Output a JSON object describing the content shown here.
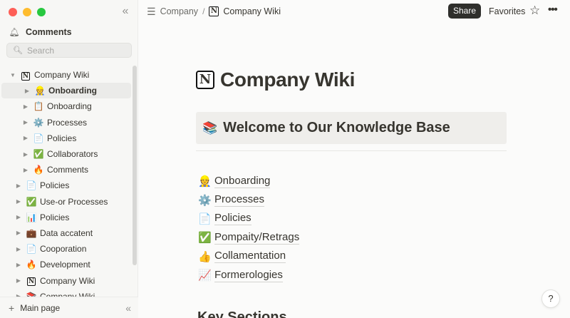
{
  "sidebar": {
    "comments_label": "Comments",
    "search_placeholder": "Search",
    "tree": [
      {
        "label": "Company Wiki",
        "emoji": "N",
        "level": 0,
        "expanded": true
      },
      {
        "label": "Onboarding",
        "emoji": "👷",
        "level": 1,
        "active": true
      },
      {
        "label": "Onboarding",
        "emoji": "📋",
        "level": 1
      },
      {
        "label": "Processes",
        "emoji": "⚙️",
        "level": 1
      },
      {
        "label": "Policies",
        "emoji": "📄",
        "level": 1
      },
      {
        "label": "Collaborators",
        "emoji": "✅",
        "level": 1
      },
      {
        "label": "Comments",
        "emoji": "🔥",
        "level": 1
      },
      {
        "label": "Policies",
        "emoji": "📄",
        "level": 0
      },
      {
        "label": "Use-or Processes",
        "emoji": "✅",
        "level": 0
      },
      {
        "label": "Policies",
        "emoji": "📊",
        "level": 0
      },
      {
        "label": "Data accatent",
        "emoji": "💼",
        "level": 0
      },
      {
        "label": "Cooporation",
        "emoji": "📄",
        "level": 0
      },
      {
        "label": "Development",
        "emoji": "🔥",
        "level": 0
      },
      {
        "label": "Company Wiki",
        "emoji": "N",
        "level": 0
      },
      {
        "label": "Company Wiki",
        "emoji": "📚",
        "level": 0
      }
    ],
    "footer_label": "Main page"
  },
  "topbar": {
    "crumb_parent": "Company",
    "crumb_separator": "/",
    "crumb_current": "Company Wiki",
    "share_label": "Share",
    "favorites_label": "Favorites"
  },
  "page": {
    "title": "Company Wiki",
    "callout_emoji": "📚",
    "callout_title": "Welcome to Our Knowledge Base",
    "links": [
      {
        "emoji": "👷",
        "label": "Onboarding"
      },
      {
        "emoji": "⚙️",
        "label": "Processes"
      },
      {
        "emoji": "📄",
        "label": "Policies"
      },
      {
        "emoji": "✅",
        "label": "Pompaity/Retrags"
      },
      {
        "emoji": "👍",
        "label": "Collamentation"
      },
      {
        "emoji": "📈",
        "label": "Formerologies"
      }
    ],
    "next_section_heading": "Key Sections"
  },
  "help_label": "?"
}
